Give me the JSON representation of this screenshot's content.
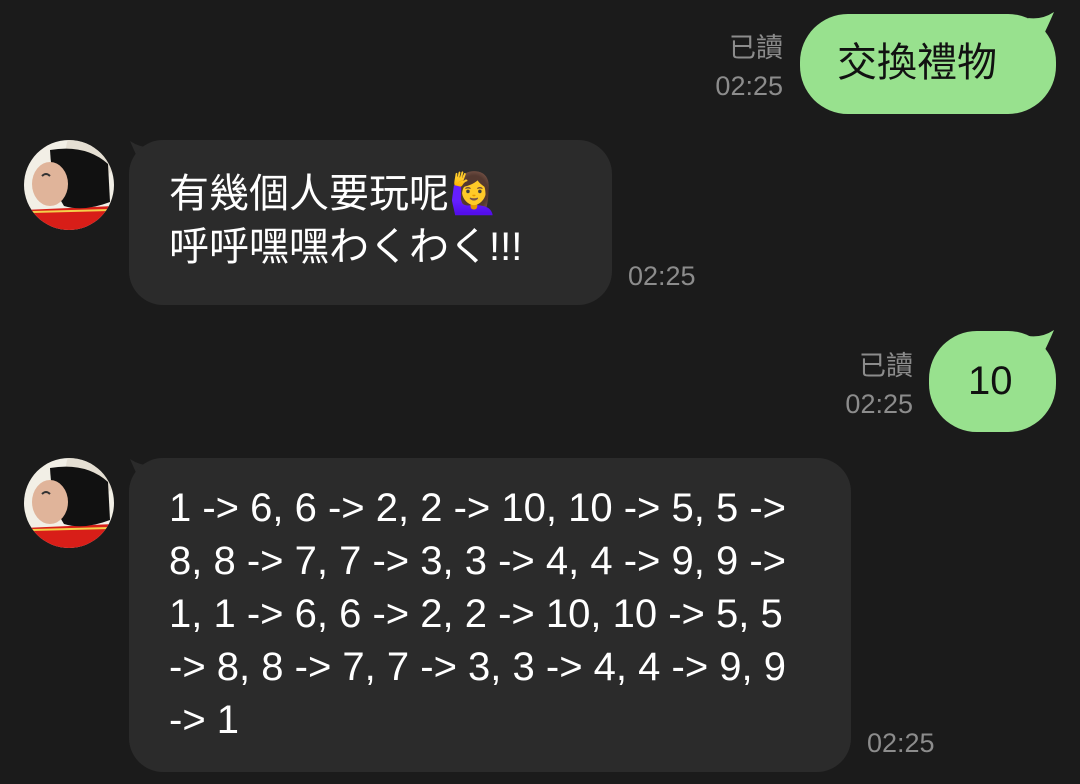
{
  "messages": [
    {
      "direction": "outgoing",
      "text": "交換禮物",
      "read_label": "已讀",
      "time": "02:25"
    },
    {
      "direction": "incoming",
      "lines": [
        "有幾個人要玩呢🙋‍♀️",
        "呼呼嘿嘿わくわく!!!"
      ],
      "time": "02:25"
    },
    {
      "direction": "outgoing",
      "text": "10",
      "read_label": "已讀",
      "time": "02:25"
    },
    {
      "direction": "incoming",
      "lines": [
        "1 -> 6, 6 -> 2, 2 -> 10, 10 -> 5, 5 ->",
        "8, 8 -> 7, 7 -> 3, 3 -> 4, 4 -> 9, 9 ->",
        "1, 1 -> 6, 6 -> 2, 2 -> 10, 10 -> 5, 5",
        "-> 8, 8 -> 7, 7 -> 3, 3 -> 4, 4 -> 9, 9",
        "-> 1"
      ],
      "time": "02:25"
    }
  ],
  "colors": {
    "background": "#1b1b1b",
    "outgoing_bubble": "#98e18e",
    "incoming_bubble": "#2b2b2b",
    "meta_text": "#8c8c8c"
  }
}
